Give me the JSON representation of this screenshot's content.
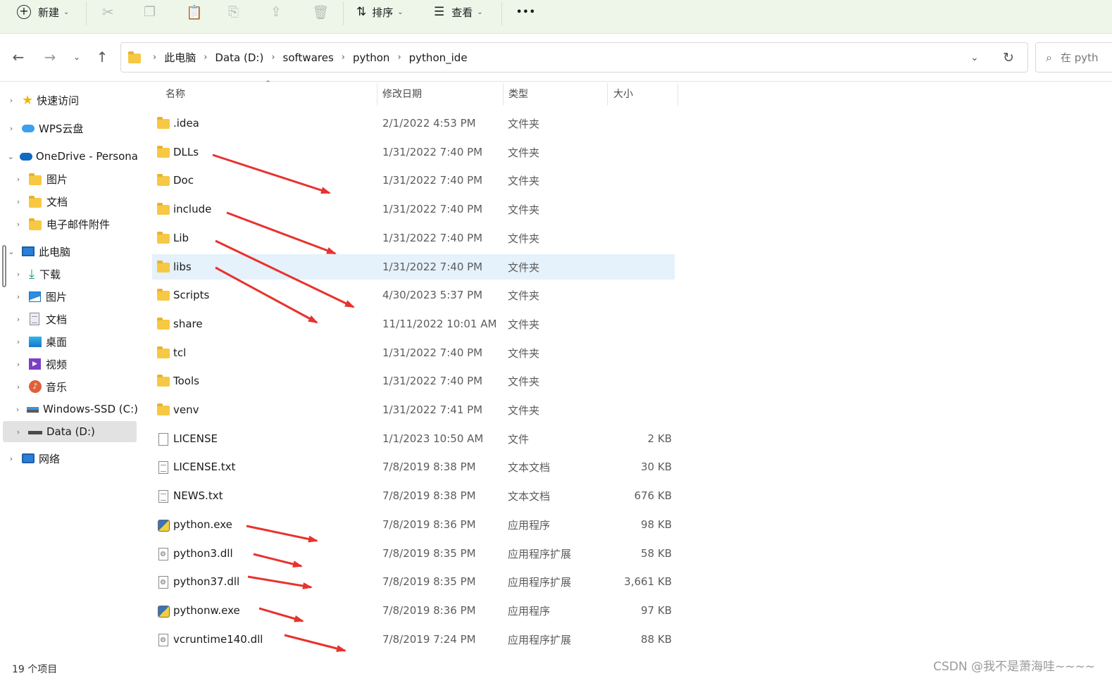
{
  "toolbar": {
    "new_label": "新建",
    "sort_label": "排序",
    "view_label": "查看",
    "more_label": "•••"
  },
  "address": {
    "crumbs": [
      "此电脑",
      "Data (D:)",
      "softwares",
      "python",
      "python_ide"
    ]
  },
  "search": {
    "placeholder": "在 pyth"
  },
  "sidebar": {
    "items": [
      {
        "label": "快速访问",
        "icon": "star-icon"
      },
      {
        "label": "WPS云盘",
        "icon": "cloud-icon"
      },
      {
        "label": "OneDrive - Persona",
        "icon": "onedrive-icon"
      },
      {
        "label": "图片",
        "icon": "folder-icon"
      },
      {
        "label": "文档",
        "icon": "folder-icon"
      },
      {
        "label": "电子邮件附件",
        "icon": "folder-icon"
      },
      {
        "label": "此电脑",
        "icon": "computer-icon"
      },
      {
        "label": "下载",
        "icon": "download-icon"
      },
      {
        "label": "图片",
        "icon": "pictures-icon"
      },
      {
        "label": "文档",
        "icon": "documents-icon"
      },
      {
        "label": "桌面",
        "icon": "desktop-icon"
      },
      {
        "label": "视频",
        "icon": "video-icon"
      },
      {
        "label": "音乐",
        "icon": "music-icon"
      },
      {
        "label": "Windows-SSD (C:)",
        "icon": "drive-c-icon"
      },
      {
        "label": "Data (D:)",
        "icon": "drive-d-icon"
      },
      {
        "label": "网络",
        "icon": "network-icon"
      }
    ]
  },
  "columns": {
    "name": "名称",
    "date": "修改日期",
    "type": "类型",
    "size": "大小"
  },
  "files": [
    {
      "name": ".idea",
      "date": "2/1/2022 4:53 PM",
      "type": "文件夹",
      "size": "",
      "kind": "folder"
    },
    {
      "name": "DLLs",
      "date": "1/31/2022 7:40 PM",
      "type": "文件夹",
      "size": "",
      "kind": "folder"
    },
    {
      "name": "Doc",
      "date": "1/31/2022 7:40 PM",
      "type": "文件夹",
      "size": "",
      "kind": "folder"
    },
    {
      "name": "include",
      "date": "1/31/2022 7:40 PM",
      "type": "文件夹",
      "size": "",
      "kind": "folder"
    },
    {
      "name": "Lib",
      "date": "1/31/2022 7:40 PM",
      "type": "文件夹",
      "size": "",
      "kind": "folder"
    },
    {
      "name": "libs",
      "date": "1/31/2022 7:40 PM",
      "type": "文件夹",
      "size": "",
      "kind": "folder"
    },
    {
      "name": "Scripts",
      "date": "4/30/2023 5:37 PM",
      "type": "文件夹",
      "size": "",
      "kind": "folder"
    },
    {
      "name": "share",
      "date": "11/11/2022 10:01 AM",
      "type": "文件夹",
      "size": "",
      "kind": "folder"
    },
    {
      "name": "tcl",
      "date": "1/31/2022 7:40 PM",
      "type": "文件夹",
      "size": "",
      "kind": "folder"
    },
    {
      "name": "Tools",
      "date": "1/31/2022 7:40 PM",
      "type": "文件夹",
      "size": "",
      "kind": "folder"
    },
    {
      "name": "venv",
      "date": "1/31/2022 7:41 PM",
      "type": "文件夹",
      "size": "",
      "kind": "folder"
    },
    {
      "name": "LICENSE",
      "date": "1/1/2023 10:50 AM",
      "type": "文件",
      "size": "2 KB",
      "kind": "file"
    },
    {
      "name": "LICENSE.txt",
      "date": "7/8/2019 8:38 PM",
      "type": "文本文档",
      "size": "30 KB",
      "kind": "text"
    },
    {
      "name": "NEWS.txt",
      "date": "7/8/2019 8:38 PM",
      "type": "文本文档",
      "size": "676 KB",
      "kind": "text"
    },
    {
      "name": "python.exe",
      "date": "7/8/2019 8:36 PM",
      "type": "应用程序",
      "size": "98 KB",
      "kind": "exe"
    },
    {
      "name": "python3.dll",
      "date": "7/8/2019 8:35 PM",
      "type": "应用程序扩展",
      "size": "58 KB",
      "kind": "dll"
    },
    {
      "name": "python37.dll",
      "date": "7/8/2019 8:35 PM",
      "type": "应用程序扩展",
      "size": "3,661 KB",
      "kind": "dll"
    },
    {
      "name": "pythonw.exe",
      "date": "7/8/2019 8:36 PM",
      "type": "应用程序",
      "size": "97 KB",
      "kind": "exe"
    },
    {
      "name": "vcruntime140.dll",
      "date": "7/8/2019 7:24 PM",
      "type": "应用程序扩展",
      "size": "88 KB",
      "kind": "dll"
    }
  ],
  "status": {
    "count": "19 个项目"
  },
  "watermark": "CSDN @我不是萧海哇~~~~",
  "colors": {
    "toolbar_bg": "#eef6e9",
    "selected_row": "#e5f1fb",
    "arrow": "#e8322d",
    "folder": "#f7c843"
  }
}
